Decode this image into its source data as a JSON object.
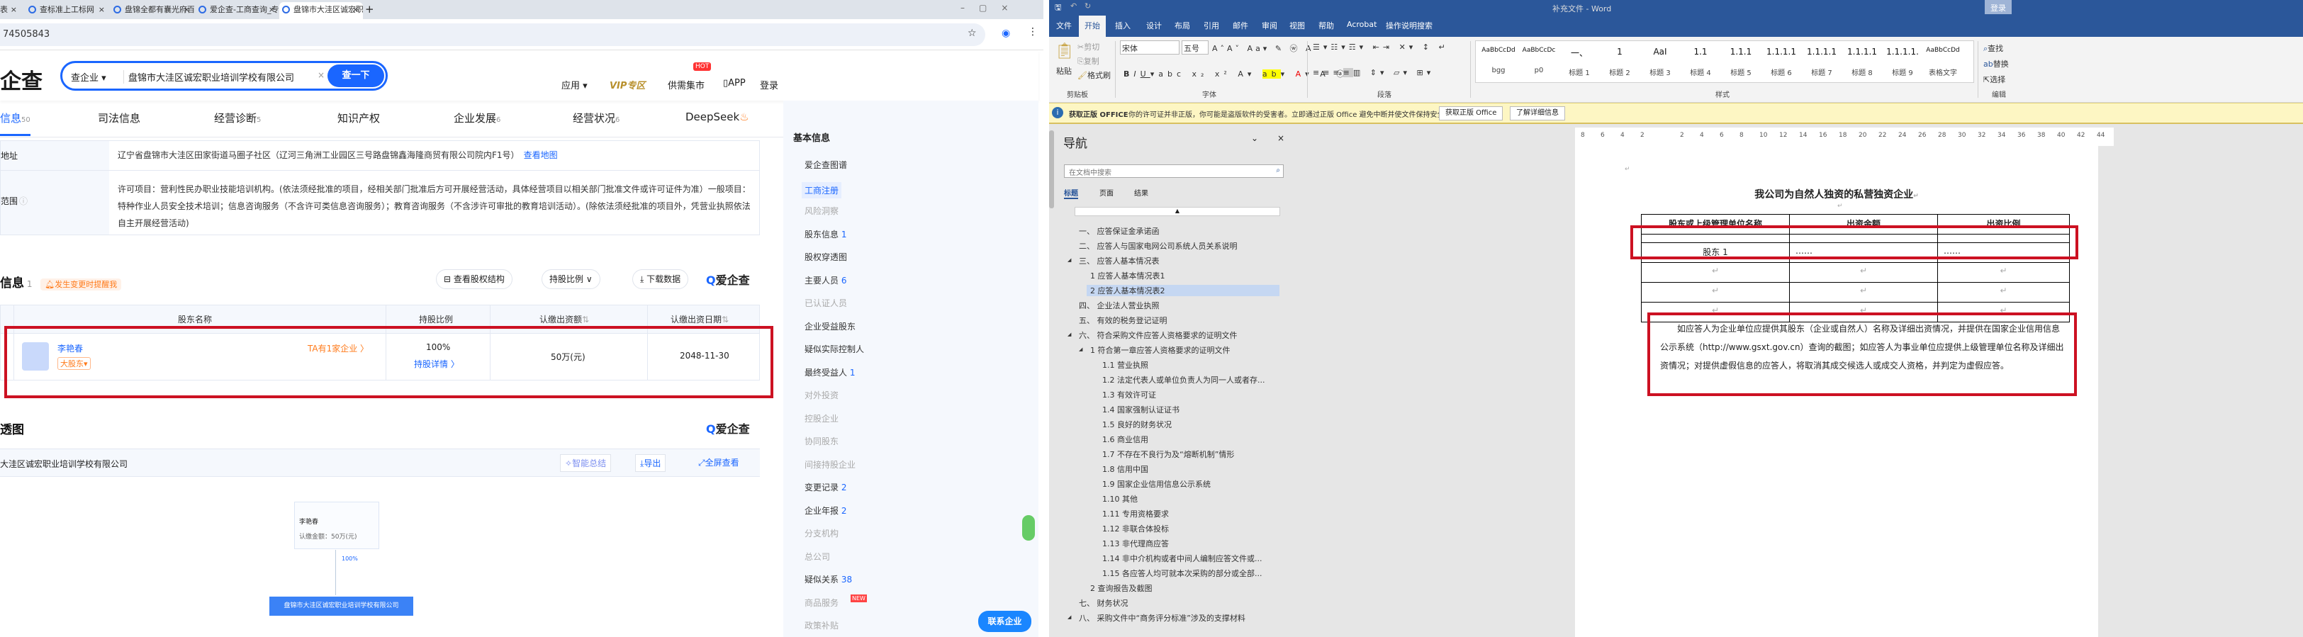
{
  "browser": {
    "tabs": [
      {
        "title": "表"
      },
      {
        "title": "查标准上工标网"
      },
      {
        "title": "盘锦全都有囊光府百货超市有限"
      },
      {
        "title": "爱企查-工商查询_专业企业信息"
      },
      {
        "title": "盘锦市大洼区诚宏职业培训学校"
      }
    ],
    "url": "74505843",
    "new_tab": "+"
  },
  "site": {
    "logo": "爱企查",
    "search_type": "查企业 ▾",
    "search_value": "盘锦市大洼区诚宏职业培训学校有限公司",
    "search_button": "查一下",
    "nav": {
      "apps": "应用 ▾",
      "vip": "VIP专区",
      "market": "供需集市",
      "hot": "HOT",
      "app": "APP",
      "login": "登录"
    },
    "tabs": [
      {
        "label": "信息",
        "count": "50"
      },
      {
        "label": "司法信息",
        "count": ""
      },
      {
        "label": "经营诊断",
        "count": "5"
      },
      {
        "label": "知识产权",
        "count": ""
      },
      {
        "label": "企业发展",
        "count": "6"
      },
      {
        "label": "经营状况",
        "count": "6"
      },
      {
        "label": "DeepSeek",
        "count": ""
      }
    ],
    "address_label": "地址",
    "address": "辽宁省盘锦市大洼区田家街道马圈子社区（辽河三角洲工业园区三号路盘锦鑫海隆商贸有限公司院内F1号）",
    "view_map": "查看地图",
    "scope_label": "范围",
    "scope": "许可项目：营利性民办职业技能培训机构。(依法须经批准的项目，经相关部门批准后方可开展经营活动，具体经营项目以相关部门批准文件或许可证件为准）一般项目：特种作业人员安全技术培训；信息咨询服务（不含许可类信息咨询服务）；教育咨询服务（不含涉许可审批的教育培训活动）。(除依法须经批准的项目外，凭营业执照依法自主开展经营活动)",
    "shareholder_section": {
      "title": "信息",
      "count": "1",
      "alert": "发生变更时提醒我",
      "btn_structure": "查看股权结构",
      "btn_ratio": "持股比例 ∨",
      "btn_download": "下载数据",
      "brand": "爱企查"
    },
    "table": {
      "headers": [
        "股东名称",
        "持股比例",
        "认缴出资额",
        "认缴出资日期"
      ],
      "rows": [
        {
          "name": "李艳春",
          "tag": "大股东▾",
          "link": "TA有1家企业 〉",
          "ratio": "100%",
          "ratio_link": "持股详情 〉",
          "amount": "50万(元)",
          "date": "2048-11-30"
        }
      ]
    },
    "penetration": {
      "title": "透图",
      "company": "大洼区诚宏职业培训学校有限公司",
      "btn_ai": "智能总结",
      "btn_export": "导出",
      "btn_full": "全屏查看",
      "node_person": "李艳春",
      "node_amount": "认缴金额：50万(元)",
      "edge": "100%",
      "node_company": "盘锦市大洼区诚宏职业培训学校有限公司"
    },
    "sidebar": {
      "title": "基本信息",
      "items": [
        {
          "label": "爱企查图谱",
          "count": "",
          "dim": false
        },
        {
          "label": "工商注册",
          "count": "",
          "dim": false,
          "active": true
        },
        {
          "label": "风险洞察",
          "count": "",
          "dim": true
        },
        {
          "label": "股东信息",
          "count": "1",
          "dim": false
        },
        {
          "label": "股权穿透图",
          "count": "",
          "dim": false
        },
        {
          "label": "主要人员",
          "count": "6",
          "dim": false
        },
        {
          "label": "已认证人员",
          "count": "",
          "dim": true
        },
        {
          "label": "企业受益股东",
          "count": "",
          "dim": false
        },
        {
          "label": "疑似实际控制人",
          "count": "",
          "dim": false
        },
        {
          "label": "最终受益人",
          "count": "1",
          "dim": false
        },
        {
          "label": "对外投资",
          "count": "",
          "dim": true
        },
        {
          "label": "控股企业",
          "count": "",
          "dim": true
        },
        {
          "label": "协同股东",
          "count": "",
          "dim": true
        },
        {
          "label": "间接持股企业",
          "count": "",
          "dim": true
        },
        {
          "label": "变更记录",
          "count": "2",
          "dim": false
        },
        {
          "label": "企业年报",
          "count": "2",
          "dim": false
        },
        {
          "label": "分支机构",
          "count": "",
          "dim": true
        },
        {
          "label": "总公司",
          "count": "",
          "dim": true
        },
        {
          "label": "疑似关系",
          "count": "38",
          "dim": false
        },
        {
          "label": "商品服务",
          "count": "",
          "dim": true
        },
        {
          "label": "政策补贴",
          "count": "",
          "dim": true
        }
      ],
      "new_badge": "NEW",
      "contact": "联系企业"
    }
  },
  "word": {
    "title": "补充文件 - Word",
    "login": "登录",
    "tabs": [
      "文件",
      "开始",
      "插入",
      "设计",
      "布局",
      "引用",
      "邮件",
      "审阅",
      "视图",
      "帮助",
      "Acrobat",
      "操作说明搜索"
    ],
    "clipboard": {
      "paste": "粘贴",
      "cut": "剪切",
      "copy": "复制",
      "format": "格式刷",
      "group": "剪贴板"
    },
    "font": {
      "name": "宋体",
      "size": "五号",
      "group": "字体"
    },
    "paragraph_group": "段落",
    "styles": {
      "group": "样式",
      "items": [
        {
          "preview": "AaBbCcDd",
          "label": "bgg"
        },
        {
          "preview": "AaBbCcDc",
          "label": "p0"
        },
        {
          "preview": "一、",
          "label": "标题 1"
        },
        {
          "preview": "1",
          "label": "标题 2"
        },
        {
          "preview": "AaI",
          "label": "标题 3"
        },
        {
          "preview": "1.1",
          "label": "标题 4"
        },
        {
          "preview": "1.1.1",
          "label": "标题 5"
        },
        {
          "preview": "1.1.1.1",
          "label": "标题 6"
        },
        {
          "preview": "1.1.1.1",
          "label": "标题 7"
        },
        {
          "preview": "1.1.1.1",
          "label": "标题 8"
        },
        {
          "preview": "1.1.1.1.",
          "label": "标题 9"
        },
        {
          "preview": "AaBbCcDd",
          "label": "表格文字"
        }
      ]
    },
    "editing": {
      "find": "查找",
      "replace": "替换",
      "select": "选择",
      "group": "编辑"
    },
    "message": {
      "title": "获取正版 OFFICE",
      "text": "你的许可证并非正版，你可能是盗版软件的受害者。立即通过正版 Office 避免中断并使文件保持安全。",
      "btn1": "获取正版 Office",
      "btn2": "了解详细信息"
    },
    "nav": {
      "title": "导航",
      "search_placeholder": "在文档中搜索",
      "tabs": [
        "标题",
        "页面",
        "结果"
      ],
      "items": [
        {
          "label": "一、  应答保证金承诺函",
          "level": 0
        },
        {
          "label": "二、  应答人与国家电网公司系统人员关系说明",
          "level": 0
        },
        {
          "label": "三、  应答人基本情况表",
          "level": 0,
          "expanded": true
        },
        {
          "label": "1 应答人基本情况表1",
          "level": 1
        },
        {
          "label": "2 应答人基本情况表2",
          "level": 1,
          "selected": true
        },
        {
          "label": "四、  企业法人营业执照",
          "level": 0
        },
        {
          "label": "五、  有效的税务登记证明",
          "level": 0
        },
        {
          "label": "六、  符合采购文件应答人资格要求的证明文件",
          "level": 0,
          "expanded": true
        },
        {
          "label": "1 符合第一章应答人资格要求的证明文件",
          "level": 1,
          "expanded": true
        },
        {
          "label": "1.1 营业执照",
          "level": 2
        },
        {
          "label": "1.2 法定代表人或单位负责人为同一人或者存...",
          "level": 2
        },
        {
          "label": "1.3 有效许可证",
          "level": 2
        },
        {
          "label": "1.4 国家强制认证证书",
          "level": 2
        },
        {
          "label": "1.5 良好的财务状况",
          "level": 2
        },
        {
          "label": "1.6 商业信用",
          "level": 2
        },
        {
          "label": "1.7 不存在不良行为及“熔断机制”情形",
          "level": 2
        },
        {
          "label": "1.8 信用中国",
          "level": 2
        },
        {
          "label": "1.9 国家企业信用信息公示系统",
          "level": 2
        },
        {
          "label": "1.10 其他",
          "level": 2
        },
        {
          "label": "1.11 专用资格要求",
          "level": 2
        },
        {
          "label": "1.12 非联合体投标",
          "level": 2
        },
        {
          "label": "1.13 非代理商应答",
          "level": 2
        },
        {
          "label": "1.14 非中介机构或者中间人编制应答文件或...",
          "level": 2
        },
        {
          "label": "1.15 各应答人均可就本次采购的部分或全部...",
          "level": 2
        },
        {
          "label": "2 查询报告及截图",
          "level": 1
        },
        {
          "label": "七、  财务状况",
          "level": 0
        },
        {
          "label": "八、  采购文件中“商务评分标准”涉及的支撑材料",
          "level": 0,
          "expanded": true
        }
      ]
    },
    "ruler": [
      "8",
      "6",
      "4",
      "2",
      "",
      "2",
      "4",
      "6",
      "8",
      "10",
      "12",
      "14",
      "16",
      "18",
      "20",
      "22",
      "24",
      "26",
      "28",
      "30",
      "32",
      "34",
      "36",
      "38",
      "40",
      "42",
      "44"
    ],
    "doc": {
      "title": "我公司为自然人独资的私营独资企业",
      "headers": [
        "股东或上级管理单位名称",
        "出资金额",
        "出资比例"
      ],
      "rows": [
        [
          "股东 1",
          "……",
          "……"
        ],
        [
          "",
          "",
          ""
        ],
        [
          "",
          "",
          ""
        ],
        [
          "",
          "",
          ""
        ]
      ],
      "note": "如应答人为企业单位应提供其股东（企业或自然人）名称及详细出资情况，并提供在国家企业信用信息公示系统（http://www.gsxt.gov.cn）查询的截图；如应答人为事业单位应提供上级管理单位名称及详细出资情况；对提供虚假信息的应答人，将取消其成交候选人或成交人资格，并判定为虚假应答。"
    }
  },
  "colors": {
    "brand_blue": "#1a66ff",
    "word_blue": "#2b579a",
    "highlight_red": "#cc1122",
    "vip_gold": "#b8902c",
    "orange": "#ff7a1a"
  }
}
